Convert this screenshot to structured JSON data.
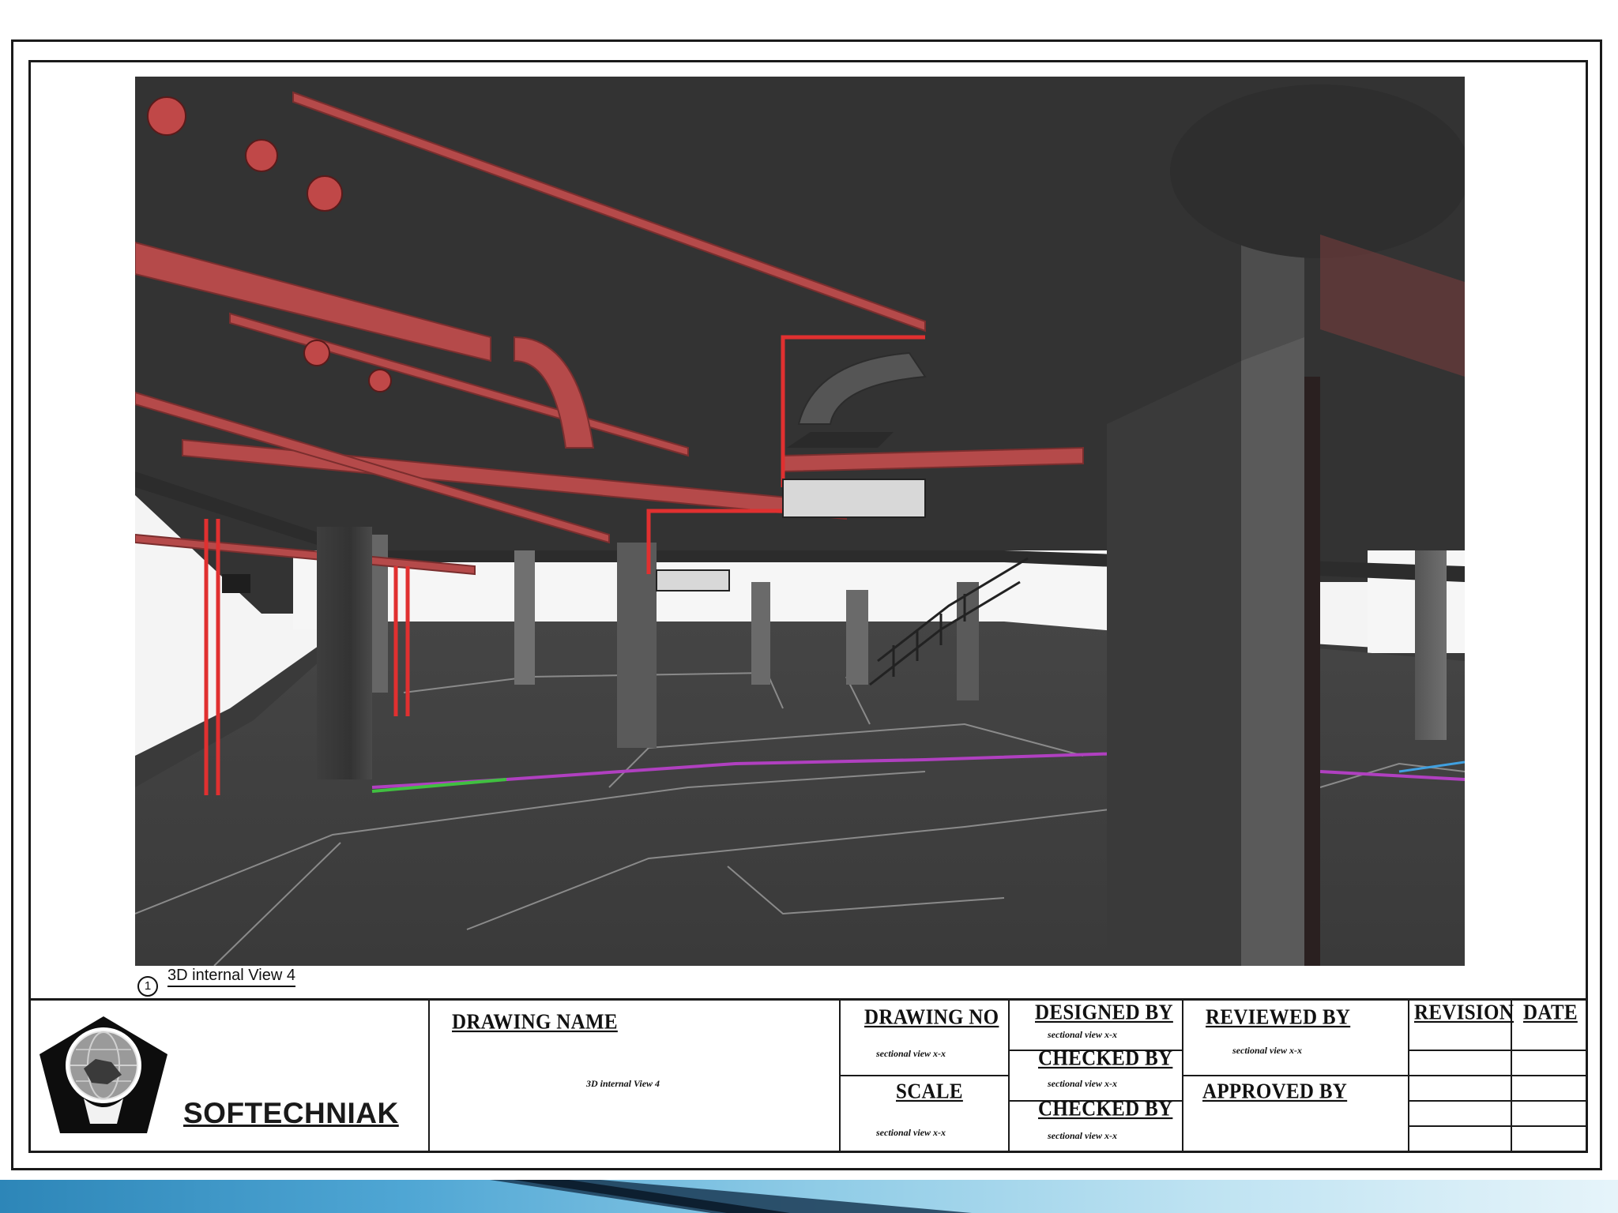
{
  "drawing": {
    "view_number": "1",
    "view_title": "3D internal  View 4"
  },
  "company": {
    "name": "SOFTECHNIAK",
    "logo_icon": "globe-shield-logo-icon"
  },
  "title_block": {
    "drawing_name_label": "DRAWING  NAME",
    "drawing_name_value": "3D internal  View 4",
    "drawing_no_label": "DRAWING  NO",
    "drawing_no_value": "sectional view x-x",
    "scale_label": "SCALE",
    "scale_value": "sectional view x-x",
    "designed_by_label": "DESIGNED BY",
    "designed_by_value": "sectional view x-x",
    "checked_by_1_label": "CHECKED  BY",
    "checked_by_1_value": "sectional view x-x",
    "checked_by_2_label": "CHECKED  BY",
    "checked_by_2_value": "sectional view x-x",
    "reviewed_by_label": "REVIEWED BY",
    "reviewed_by_value": "sectional view x-x",
    "approved_by_label": "APPROVED  BY",
    "revision_label": "REVISION",
    "date_label": "DATE"
  },
  "colors": {
    "render_background": "#3a3a3a",
    "duct_red": "#b54a4a",
    "pipe_red": "#e02a2a",
    "column_gray": "#4a4a4a",
    "floor_line_magenta": "#b040c0",
    "floor_line_green": "#40c040"
  }
}
